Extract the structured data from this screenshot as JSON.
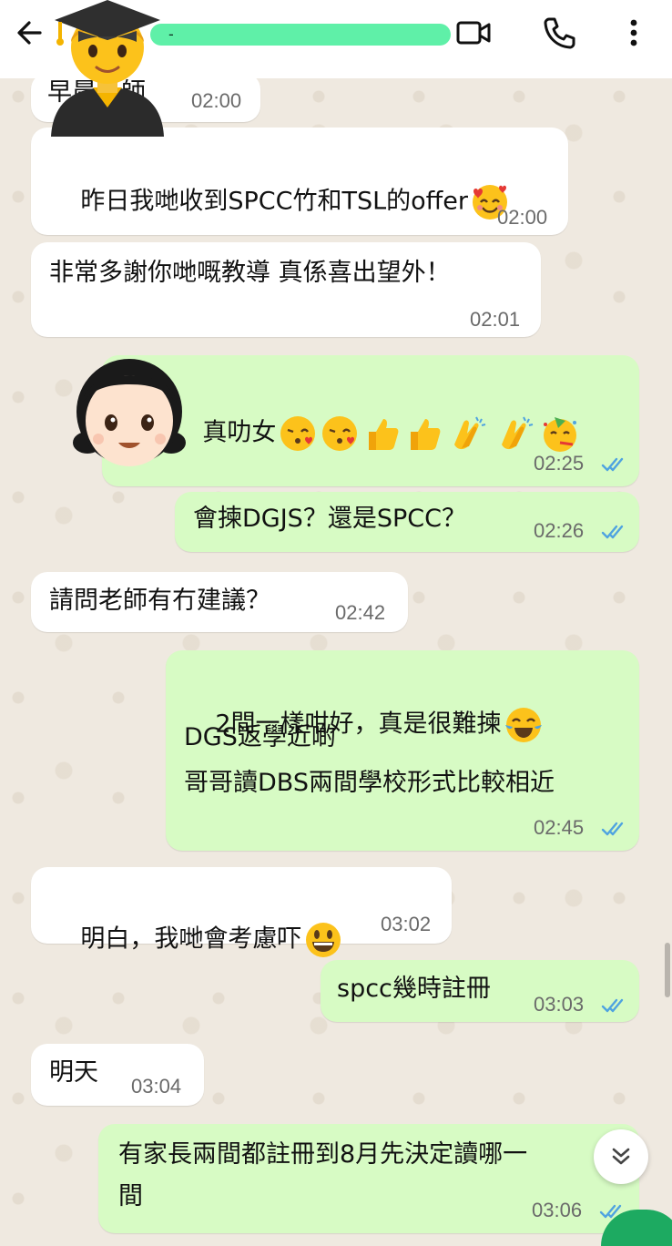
{
  "header": {
    "contact_name": "-",
    "icons": [
      "back-arrow-icon",
      "video-call-icon",
      "phone-call-icon",
      "more-menu-icon"
    ]
  },
  "messages": [
    {
      "id": "m1",
      "direction": "incoming",
      "text": "早晨老師",
      "time": "02:00"
    },
    {
      "id": "m2",
      "direction": "incoming",
      "text": "昨日我哋收到SPCC竹和TSL的offer",
      "emoji": "smiling-face-with-hearts",
      "time": "02:00"
    },
    {
      "id": "m3",
      "direction": "incoming",
      "text": "非常多謝你哋嘅教導 真係喜出望外！",
      "time": "02:01"
    },
    {
      "id": "m4",
      "direction": "outgoing",
      "text": "真叻女",
      "emojis": [
        "kissing-face",
        "kissing-face",
        "thumbs-up",
        "thumbs-up",
        "clapping-hands",
        "clapping-hands",
        "partying-face"
      ],
      "time": "02:25",
      "read": true
    },
    {
      "id": "m5",
      "direction": "outgoing",
      "text": "會揀DGJS？還是SPCC？",
      "time": "02:26",
      "read": true
    },
    {
      "id": "m6",
      "direction": "incoming",
      "text": "請問老師有冇建議？",
      "time": "02:42"
    },
    {
      "id": "m7",
      "direction": "outgoing",
      "lines": [
        "2間一樣咁好，真是很難揀",
        "DGS返學近啲",
        "哥哥讀DBS兩間學校形式比較相近"
      ],
      "emoji": "face-with-tears-of-joy",
      "time": "02:45",
      "read": true
    },
    {
      "id": "m8",
      "direction": "incoming",
      "text": "明白，我哋會考慮吓",
      "emoji": "grinning-face",
      "time": "03:02"
    },
    {
      "id": "m9",
      "direction": "outgoing",
      "text": "spcc幾時註冊",
      "time": "03:03",
      "read": true
    },
    {
      "id": "m10",
      "direction": "incoming",
      "text": "明天",
      "time": "03:04"
    },
    {
      "id": "m11",
      "direction": "outgoing",
      "lines": [
        "有家長兩間都註冊到8月先決定讀哪一",
        "間"
      ],
      "time": "03:06",
      "read": true
    }
  ],
  "colors": {
    "outgoing_bubble": "#d7fbc4",
    "incoming_bubble": "#ffffff",
    "read_tick": "#4fa3e0",
    "name_highlight": "#5ff0a8"
  }
}
